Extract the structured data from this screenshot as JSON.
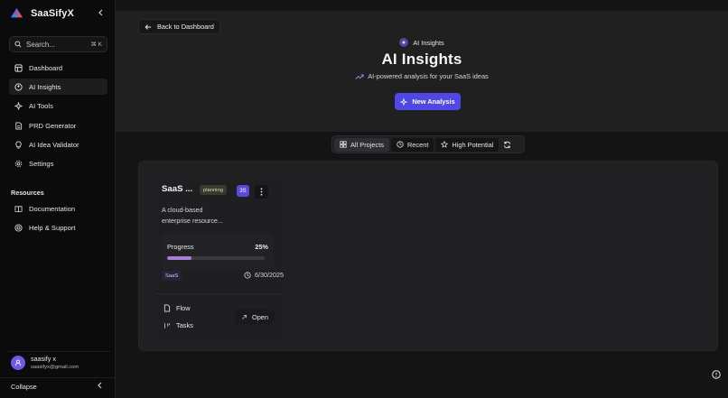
{
  "app": {
    "name": "SaaSifyX"
  },
  "search": {
    "placeholder": "Search...",
    "shortcut": "⌘ K"
  },
  "sidebar": {
    "items": [
      {
        "label": "Dashboard",
        "icon": "dashboard-icon",
        "active": false
      },
      {
        "label": "AI Insights",
        "icon": "insights-icon",
        "active": true
      },
      {
        "label": "AI Tools",
        "icon": "sparkles-icon",
        "active": false
      },
      {
        "label": "PRD Generator",
        "icon": "document-icon",
        "active": false
      },
      {
        "label": "AI Idea Validator",
        "icon": "lightbulb-icon",
        "active": false
      },
      {
        "label": "Settings",
        "icon": "gear-icon",
        "active": false
      }
    ],
    "resources_label": "Resources",
    "resources": [
      {
        "label": "Documentation",
        "icon": "book-icon"
      },
      {
        "label": "Help & Support",
        "icon": "help-icon"
      }
    ],
    "user": {
      "name": "saasify x",
      "email": "saasifyx@gmail.com"
    },
    "collapse_label": "Collapse"
  },
  "hero": {
    "back_label": "Back to Dashboard",
    "badge_label": "AI Insights",
    "title": "AI Insights",
    "subtitle": "AI-powered analysis for your SaaS ideas",
    "new_button": "New Analysis"
  },
  "filters": {
    "tabs": [
      {
        "label": "All Projects",
        "icon": "grid-icon"
      },
      {
        "label": "Recent",
        "icon": "clock-icon"
      },
      {
        "label": "High Potential",
        "icon": "star-icon"
      }
    ]
  },
  "project": {
    "title": "SaaS ...",
    "status": "planning",
    "avatar_initials": "3S",
    "description_line1": "A cloud-based",
    "description_line2": "enterprise resource...",
    "progress_label": "Progress",
    "progress_pct": "25%",
    "progress_value": 25,
    "tag": "SaaS",
    "date": "6/30/2025",
    "link_flow": "Flow",
    "link_tasks": "Tasks",
    "open_label": "Open"
  },
  "colors": {
    "accent": "#5048e5",
    "progress": "#a77dd6",
    "background": "#141414"
  }
}
